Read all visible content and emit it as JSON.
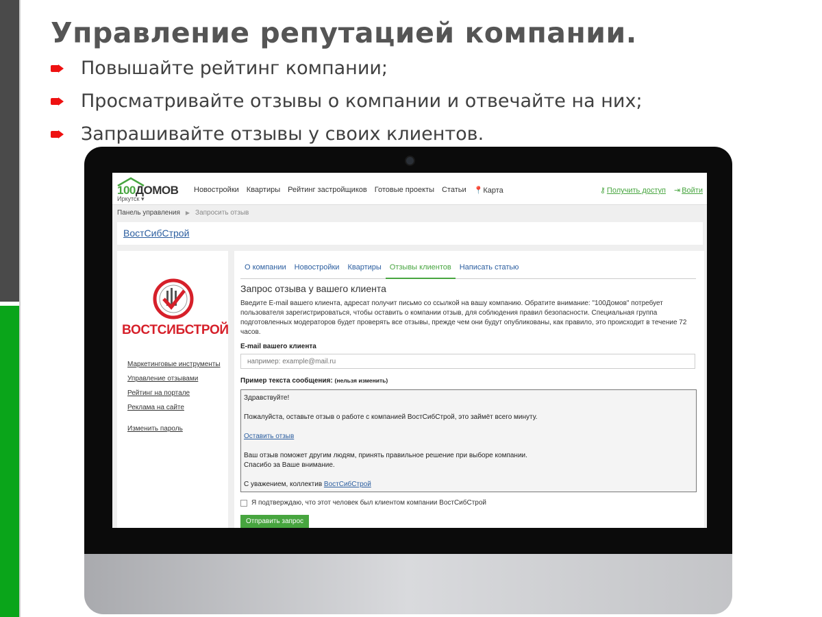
{
  "slide": {
    "title": "Управление репутацией компании.",
    "bullets": [
      "Повышайте рейтинг компании;",
      "Просматривайте отзывы о компании и отвечайте на них;",
      "Запрашивайте отзывы у своих клиентов."
    ],
    "colors": {
      "bullet": "#e11111",
      "sidebar_top": "#4a4a4a",
      "sidebar_bottom": "#0aa51a"
    }
  },
  "site": {
    "logo_part1": "100",
    "logo_part2": "ДОМОВ",
    "city": "Иркутск",
    "nav": [
      "Новостройки",
      "Квартиры",
      "Рейтинг застройщиков",
      "Готовые проекты",
      "Статьи",
      "Карта"
    ],
    "get_access": "Получить доступ",
    "login": "Войти",
    "accent": "#47a53f"
  },
  "breadcrumb": [
    "Панель управления",
    "Запросить отзыв"
  ],
  "company": {
    "link": "ВостСибСтрой",
    "logo_name": "ВОСТСИБСТРОЙ"
  },
  "sidebar_menu": [
    "Маркетинговые инструменты",
    "Управление отзывами",
    "Рейтинг на портале",
    "Реклама на сайте",
    "Изменить пароль"
  ],
  "tabs": [
    "О компании",
    "Новостройки",
    "Квартиры",
    "Отзывы клиентов",
    "Написать статью"
  ],
  "active_tab": "Отзывы клиентов",
  "form": {
    "title": "Запрос отзыва у вашего клиента",
    "intro": "Введите E-mail вашего клиента, адресат получит письмо со ссылкой на вашу компанию. Обратите внимание: \"100Домов\" потребует пользователя зарегистрироваться, чтобы оставить о компании отзыв, для соблюдения правил безопасности. Специальная группа подготовленных модераторов будет проверять все отзывы, прежде чем они будут опубликованы, как правило, это происходит в течение 72 часов.",
    "email_label": "E-mail вашего клиента",
    "email_placeholder": "например: example@mail.ru",
    "sample_label": "Пример текста сообщения:",
    "sample_note": "(нельзя изменить)",
    "message": {
      "greeting": "Здравствуйте!",
      "line1": "Пожалуйста, оставьте отзыв о работе с компанией ВостСибСтрой, это займёт всего минуту.",
      "link": "Оставить отзыв",
      "line2": "Ваш отзыв поможет другим людям, принять правильное решение при выборе компании.",
      "line3": "Спасибо за Ваше внимание.",
      "signature_prefix": "С уважением, коллектив",
      "signature_link": "ВостСибСтрой"
    },
    "confirm": "Я подтверждаю, что этот человек был клиентом компании ВостСибСтрой",
    "submit": "Отправить запрос"
  }
}
